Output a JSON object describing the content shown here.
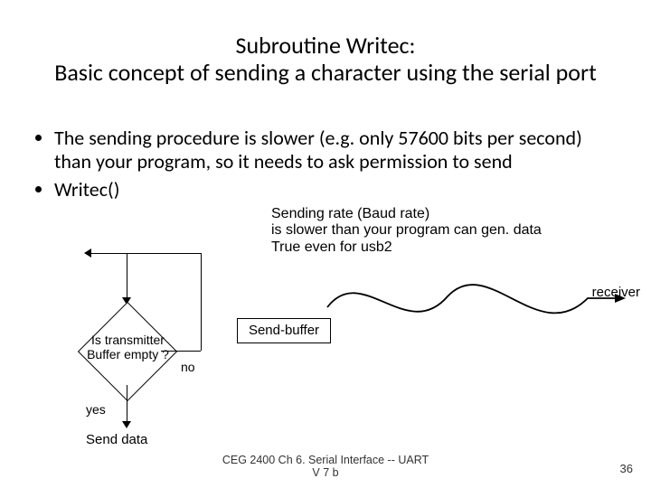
{
  "title_line1": "Subroutine Writec:",
  "title_line2": "Basic concept  of sending a character using the serial port",
  "bullets": {
    "item1": "The sending procedure is slower (e.g. only 57600 bits per second)  than your program, so it needs to ask permission to send",
    "item2": "Writec()"
  },
  "sidenote_line1": "Sending rate (Baud rate)",
  "sidenote_line2": " is slower than your program can gen. data",
  "sidenote_line3": "True even for usb2",
  "flow": {
    "decision_line1": "Is transmitter",
    "decision_line2": "Buffer empty ?",
    "no_label": "no",
    "yes_label": "yes",
    "send_data": "Send data"
  },
  "send_buffer": "Send-buffer",
  "receiver_label": "receiver",
  "footer_line1": "CEG 2400 Ch 6. Serial Interface -- UART",
  "footer_line2": "V 7 b",
  "page_number": "36"
}
